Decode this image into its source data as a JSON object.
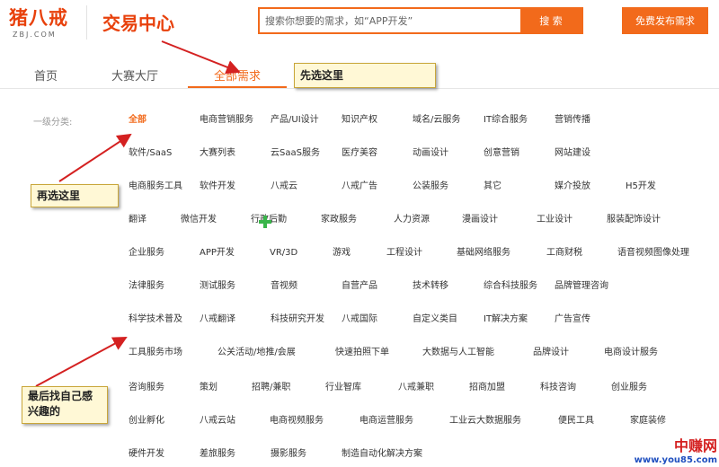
{
  "header": {
    "logo_text": "猪八戒",
    "logo_sub": "ZBJ.COM",
    "title": "交易中心",
    "search_placeholder": "搜索你想要的需求，如“APP开发”",
    "search_button": "搜 索",
    "publish_button": "免费发布需求"
  },
  "tabs": [
    {
      "label": "首页"
    },
    {
      "label": "大赛大厅"
    },
    {
      "label": "全部需求",
      "active": true
    }
  ],
  "section_label": "一级分类:",
  "categories": [
    [
      "全部",
      "电商营销服务",
      "产品/UI设计",
      "知识产权",
      "域名/云服务",
      "IT综合服务",
      "营销传播"
    ],
    [
      "软件/SaaS",
      "大赛列表",
      "云SaaS服务",
      "医疗美容",
      "动画设计",
      "创意营销",
      "网站建设"
    ],
    [
      "电商服务工具",
      "软件开发",
      "八戒云",
      "八戒广告",
      "公装服务",
      "其它",
      "媒介投放",
      "H5开发"
    ],
    [
      "翻译",
      "微信开发",
      "行政后勤",
      "家政服务",
      "人力资源",
      "漫画设计",
      "工业设计",
      "服装配饰设计"
    ],
    [
      "企业服务",
      "APP开发",
      "VR/3D",
      "游戏",
      "工程设计",
      "基础网络服务",
      "工商财税",
      "语音视频图像处理"
    ],
    [
      "法律服务",
      "测试服务",
      "音视频",
      "自营产品",
      "技术转移",
      "综合科技服务",
      "品牌管理咨询"
    ],
    [
      "科学技术普及",
      "八戒翻译",
      "科技研究开发",
      "八戒国际",
      "自定义类目",
      "IT解决方案",
      "广告宣传"
    ],
    [
      "工具服务市场",
      "公关活动/地推/会展",
      "快速拍照下单",
      "大数据与人工智能",
      "品牌设计",
      "电商设计服务"
    ],
    [
      "咨询服务",
      "策划",
      "招聘/兼职",
      "行业智库",
      "八戒兼职",
      "招商加盟",
      "科技咨询",
      "创业服务"
    ],
    [
      "创业孵化",
      "八戒云站",
      "电商视频服务",
      "电商运营服务",
      "工业云大数据服务",
      "便民工具",
      "家庭装修"
    ],
    [
      "硬件开发",
      "差旅服务",
      "摄影服务",
      "制造自动化解决方案"
    ]
  ],
  "annotations": {
    "first": "先选这里",
    "second": "再选这里",
    "third": "最后找自己感兴趣的"
  },
  "watermark": {
    "main": "中赚网",
    "url": "www.you85.com"
  },
  "colors": {
    "brand_orange": "#f26a1b",
    "annotation_red": "#d42121"
  }
}
